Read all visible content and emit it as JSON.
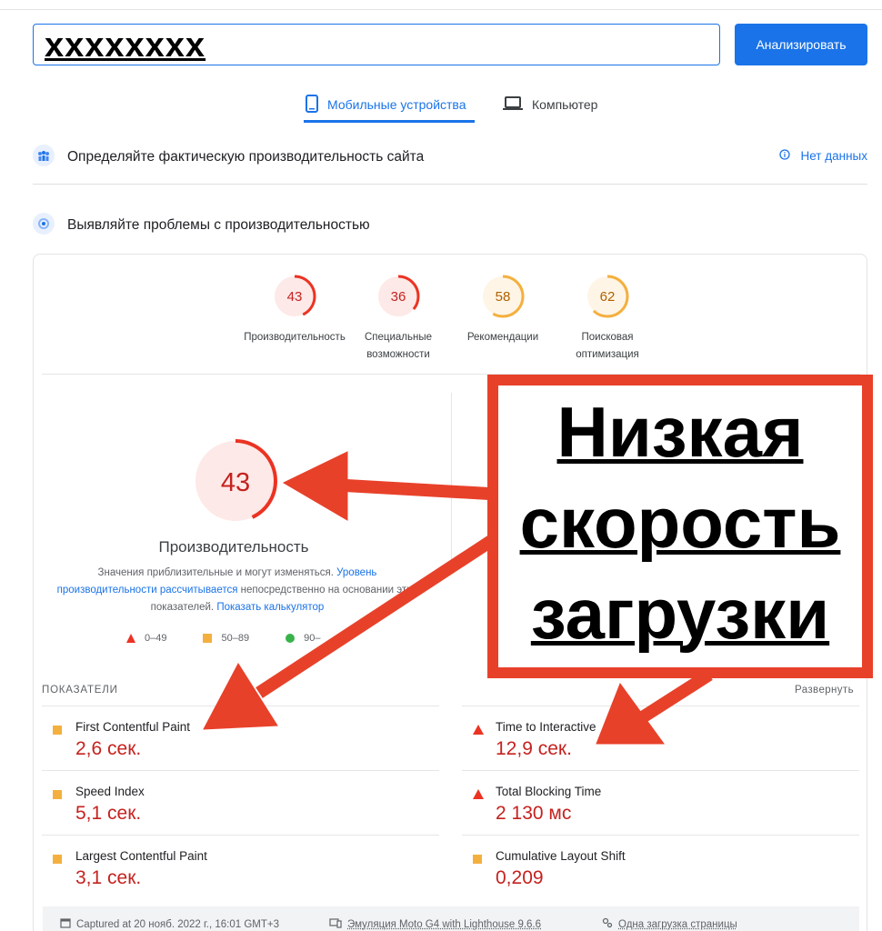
{
  "search": {
    "url_value": "xxxxxxxx",
    "analyze_label": "Анализировать"
  },
  "tabs": {
    "mobile": "Мобильные устройства",
    "desktop": "Компьютер"
  },
  "field_data": {
    "title": "Определяйте фактическую производительность сайта",
    "status": "Нет данных"
  },
  "lab_data": {
    "title": "Выявляйте проблемы с производительностью"
  },
  "scores": [
    {
      "value": "43",
      "label": "Производительность",
      "fraction": 0.43,
      "color": "#eb3323",
      "bg": "#fde9e7"
    },
    {
      "value": "36",
      "label": "Специальные возможности",
      "fraction": 0.36,
      "color": "#eb3323",
      "bg": "#fde9e7"
    },
    {
      "value": "58",
      "label": "Рекомендации",
      "fraction": 0.58,
      "color": "#f4b03e",
      "bg": "#fef5e6"
    },
    {
      "value": "62",
      "label": "Поисковая оптимизация",
      "fraction": 0.62,
      "color": "#f4b03e",
      "bg": "#fef5e6"
    }
  ],
  "performance": {
    "score": "43",
    "fraction": 0.43,
    "title": "Производительность",
    "desc_part1": "Значения приблизительные и могут изменяться. ",
    "desc_link1": "Уровень производительности рассчитывается",
    "desc_part2": " непосредственно на основании этих показателей. ",
    "desc_link2": "Показать калькулятор"
  },
  "legend": {
    "red": "0–49",
    "orange": "50–89",
    "green": "90–"
  },
  "metrics": {
    "header": "ПОКАЗАТЕЛИ",
    "expand_label": "Развернуть",
    "items": [
      {
        "name": "First Contentful Paint",
        "value": "2,6 сек.",
        "rating": "average"
      },
      {
        "name": "Time to Interactive",
        "value": "12,9 сек.",
        "rating": "poor"
      },
      {
        "name": "Speed Index",
        "value": "5,1 сек.",
        "rating": "average"
      },
      {
        "name": "Total Blocking Time",
        "value": "2 130 мс",
        "rating": "poor"
      },
      {
        "name": "Largest Contentful Paint",
        "value": "3,1 сек.",
        "rating": "average"
      },
      {
        "name": "Cumulative Layout Shift",
        "value": "0,209",
        "rating": "average"
      }
    ]
  },
  "footer": {
    "captured": "Captured at 20 нояб. 2022 г., 16:01 GMT+3",
    "emulation": "Эмуляция Moto G4 with Lighthouse 9.6.6",
    "load": "Одна загрузка страницы"
  },
  "annotation": {
    "line1": "Низкая",
    "line2": "скорость",
    "line3": "загрузки",
    "color": "#e8412a"
  }
}
